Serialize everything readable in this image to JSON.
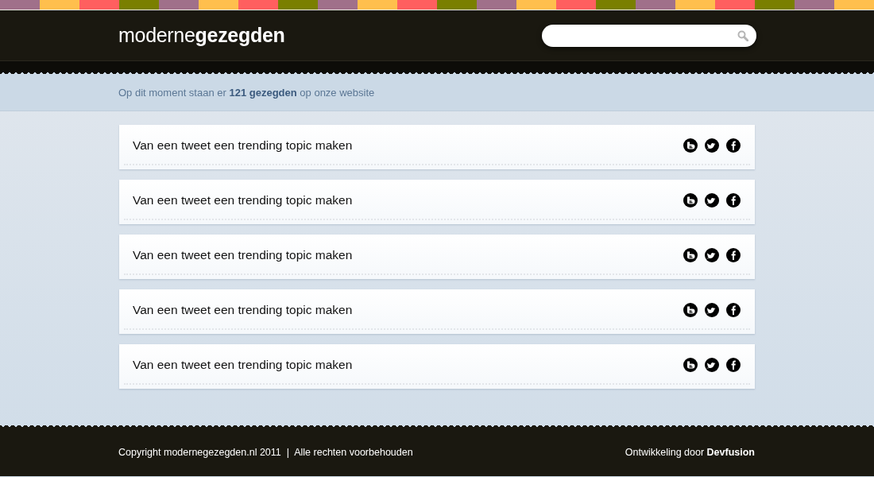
{
  "header": {
    "logo": "moderne**gezegden**"
  },
  "info": "Op dit moment staan er **121 gezegden** op onze website",
  "sayings": [
    {
      "text": "Van een tweet een trending topic maken"
    },
    {
      "text": "Van een tweet een trending topic maken"
    },
    {
      "text": "Van een tweet een trending topic maken"
    },
    {
      "text": "Van een tweet een trending topic maken"
    },
    {
      "text": "Van een tweet een trending topic maken"
    }
  ],
  "footer": {
    "copyright": "Copyright modernegezegden.nl 2011  |  Alle rechten voorbehouden",
    "credit": "Ontwikkeling door **Devfusion**"
  }
}
